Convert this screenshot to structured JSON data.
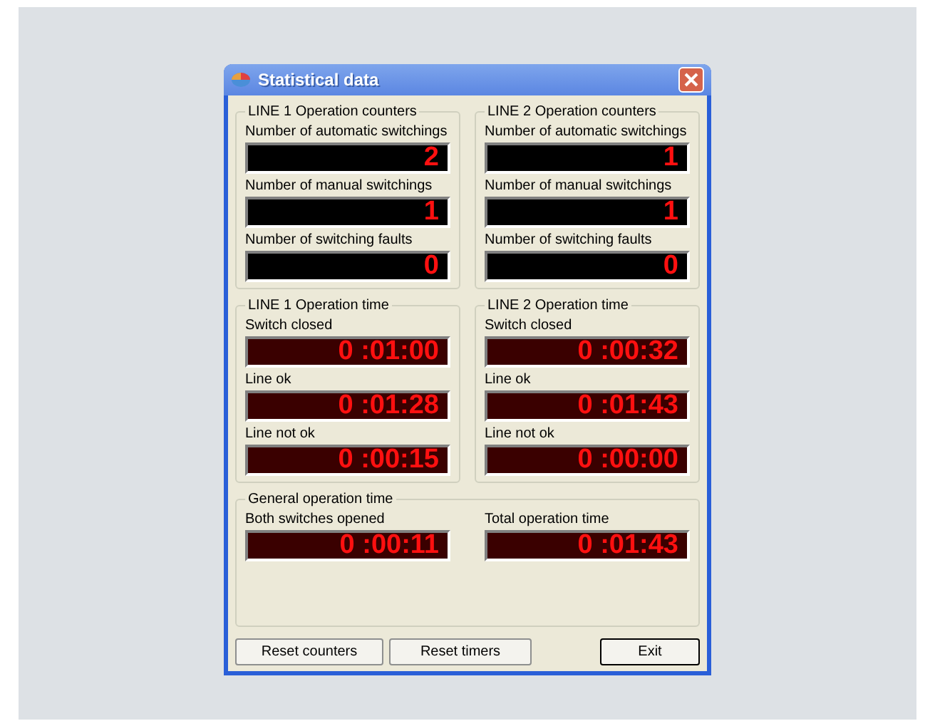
{
  "window": {
    "title": "Statistical data"
  },
  "counter_groups": [
    {
      "title": "LINE 1 Operation counters",
      "rows": [
        {
          "label": "Number of automatic switchings",
          "value": "2"
        },
        {
          "label": "Number of manual switchings",
          "value": "1"
        },
        {
          "label": "Number of switching faults",
          "value": "0"
        }
      ]
    },
    {
      "title": "LINE 2 Operation counters",
      "rows": [
        {
          "label": "Number of automatic switchings",
          "value": "1"
        },
        {
          "label": "Number of manual switchings",
          "value": "1"
        },
        {
          "label": "Number of switching faults",
          "value": "0"
        }
      ]
    }
  ],
  "time_groups": [
    {
      "title": "LINE 1 Operation time",
      "rows": [
        {
          "label": "Switch closed",
          "value": "0 :01:00"
        },
        {
          "label": "Line ok",
          "value": "0 :01:28"
        },
        {
          "label": "Line not ok",
          "value": "0 :00:15"
        }
      ]
    },
    {
      "title": "LINE 2 Operation time",
      "rows": [
        {
          "label": "Switch closed",
          "value": "0 :00:32"
        },
        {
          "label": "Line ok",
          "value": "0 :01:43"
        },
        {
          "label": "Line not ok",
          "value": "0 :00:00"
        }
      ]
    }
  ],
  "general": {
    "title": "General operation time",
    "rows": [
      {
        "label": "Both switches opened",
        "value": "0 :00:11"
      },
      {
        "label": "Total operation time",
        "value": "0 :01:43"
      }
    ]
  },
  "buttons": [
    {
      "label": "Reset counters"
    },
    {
      "label": "Reset timers"
    },
    {
      "label": "Exit"
    }
  ]
}
